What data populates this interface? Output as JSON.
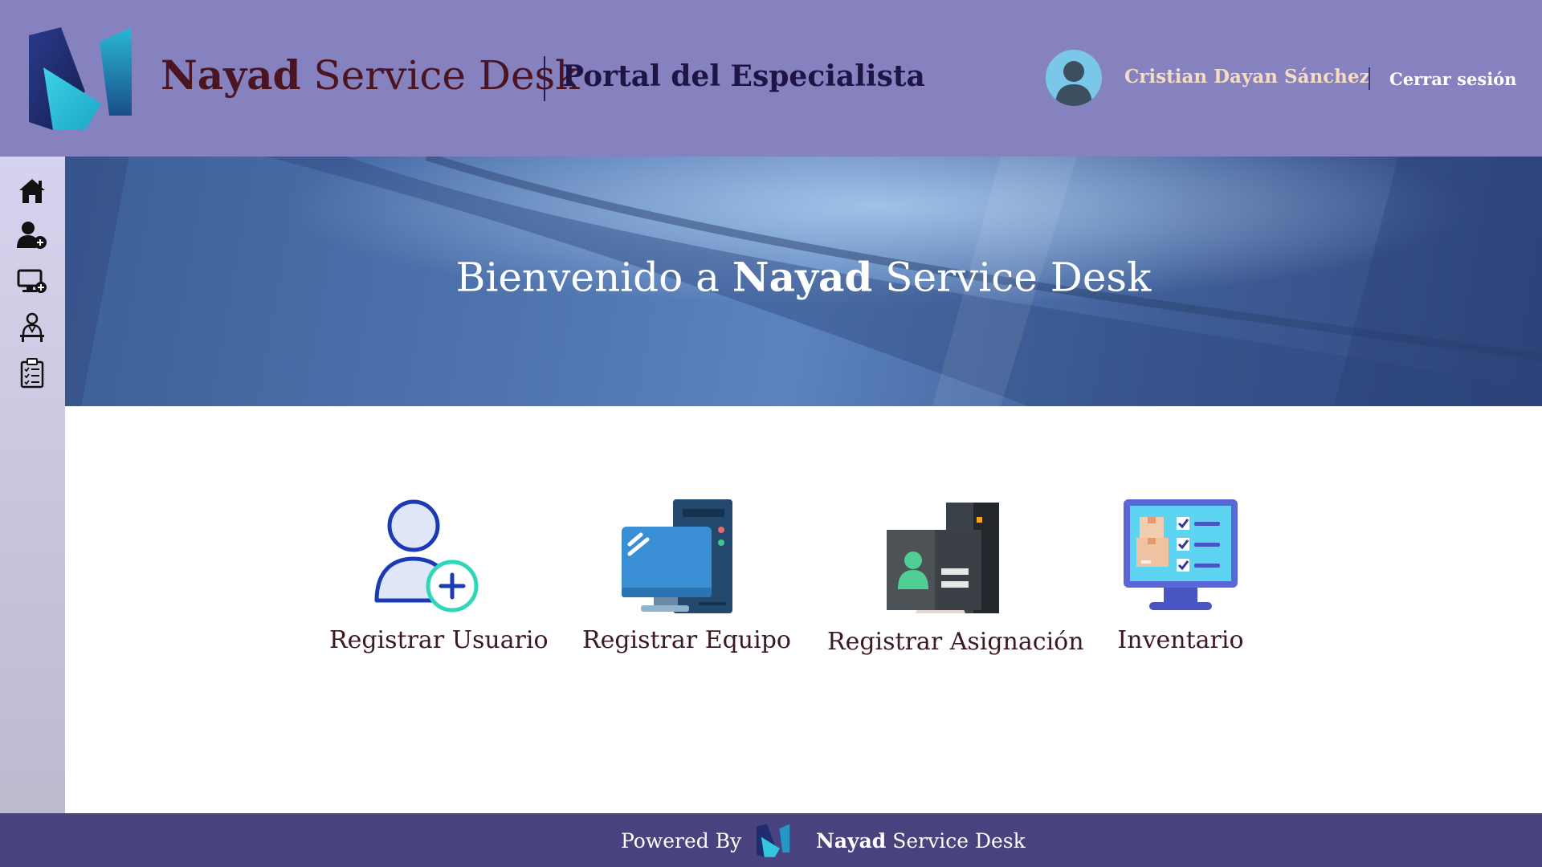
{
  "header": {
    "brand_bold": "Nayad",
    "brand_rest": " Service Desk",
    "portal_title": "Portal del Especialista",
    "user_name": "Cristian Dayan Sánchez",
    "logout_label": "Cerrar sesión"
  },
  "sidebar": {
    "items": [
      {
        "icon": "home-icon"
      },
      {
        "icon": "add-user-icon"
      },
      {
        "icon": "add-computer-icon"
      },
      {
        "icon": "specialist-icon"
      },
      {
        "icon": "checklist-icon"
      }
    ]
  },
  "hero": {
    "prefix": "Bienvenido a ",
    "brand_bold": "Nayad",
    "brand_rest": " Service Desk"
  },
  "cards": [
    {
      "label": "Registrar Usuario",
      "icon": "add-user-icon"
    },
    {
      "label": "Registrar Equipo",
      "icon": "desktop-computer-icon"
    },
    {
      "label": "Registrar Asignación",
      "icon": "id-card-icon"
    },
    {
      "label": "Inventario",
      "icon": "inventory-monitor-icon"
    }
  ],
  "footer": {
    "powered_by": "Powered By",
    "brand_bold": "Nayad",
    "brand_rest": " Service Desk"
  },
  "colors": {
    "header_bg": "#8681bf",
    "footer_bg": "#48427f",
    "brand_text": "#4a1520",
    "user_name": "#f3dcc0"
  }
}
